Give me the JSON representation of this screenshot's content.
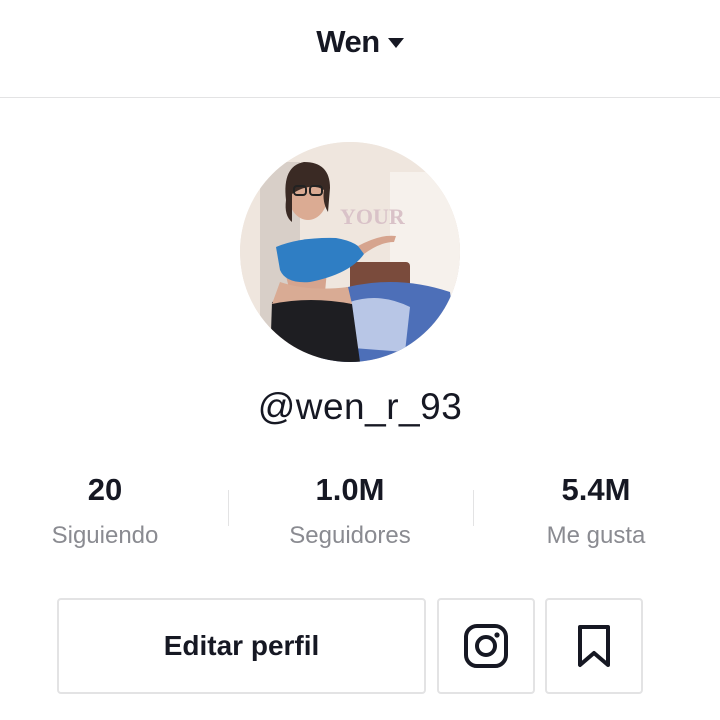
{
  "header": {
    "title": "Wen",
    "dropdown_icon": "caret-down-icon"
  },
  "profile": {
    "username": "@wen_r_93",
    "avatar_alt": "profile photo"
  },
  "stats": [
    {
      "value": "20",
      "label": "Siguiendo"
    },
    {
      "value": "1.0M",
      "label": "Seguidores"
    },
    {
      "value": "5.4M",
      "label": "Me gusta"
    }
  ],
  "actions": {
    "edit_profile_label": "Editar perfil",
    "instagram_icon": "instagram-icon",
    "bookmark_icon": "bookmark-icon"
  },
  "colors": {
    "text_primary": "#161823",
    "text_secondary": "#8a8b91",
    "border": "#e3e3e4"
  }
}
